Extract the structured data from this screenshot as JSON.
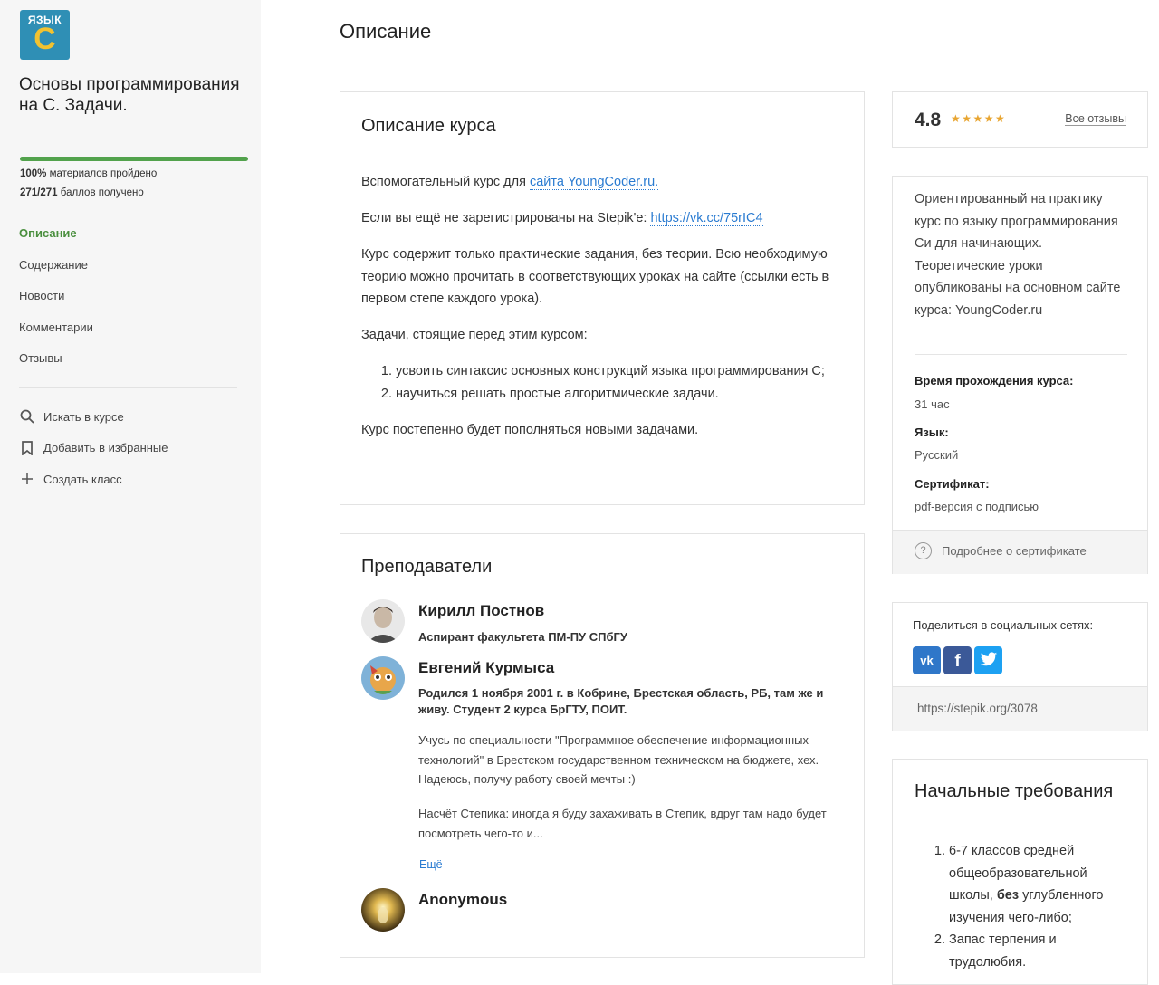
{
  "sidebar": {
    "logo": {
      "word": "ЯЗЫК",
      "letter": "С"
    },
    "course_title": "Основы программирования на С. Задачи.",
    "progress": {
      "fraction": 1.0,
      "materials_value": "100%",
      "materials_text": "материалов пройдено",
      "points_value": "271/271",
      "points_text": "баллов получено"
    },
    "nav": [
      {
        "label": "Описание",
        "active": true
      },
      {
        "label": "Содержание"
      },
      {
        "label": "Новости"
      },
      {
        "label": "Комментарии"
      },
      {
        "label": "Отзывы"
      }
    ],
    "actions": [
      {
        "label": "Искать в курсе",
        "icon": "search-icon"
      },
      {
        "label": "Добавить в избранные",
        "icon": "bookmark-icon"
      },
      {
        "label": "Создать класс",
        "icon": "plus-icon"
      }
    ]
  },
  "main": {
    "page_title": "Описание",
    "description": {
      "heading": "Описание курса",
      "p1_prefix": "Вспомогательный курс для ",
      "p1_link": "сайта YoungCoder.ru.",
      "p2_prefix": "Если вы ещё не зарегистрированы на Stepik'е: ",
      "p2_link": "https://vk.cc/75rIC4",
      "p3": "Курс содержит только практические задания, без теории. Всю необходимую теорию можно прочитать в соответствующих уроках на сайте (ссылки есть в первом степе каждого урока).",
      "p4": "Задачи, стоящие перед этим курсом:",
      "goals": [
        "усвоить синтаксис основных конструкций языка программирования С;",
        "научиться решать простые алгоритмические задачи."
      ],
      "p5": "Курс постепенно будет пополняться новыми задачами."
    },
    "teachers": {
      "heading": "Преподаватели",
      "list": [
        {
          "name": "Кирилл Постнов",
          "subtitle": "Аспирант факультета ПМ-ПУ СПбГУ"
        },
        {
          "name": "Евгений Курмыса",
          "subtitle": "Родился 1 ноября 2001 г. в Кобрине, Брестская область, РБ, там же и живу. Студент 2 курса БрГТУ, ПОИТ.",
          "bio1": "Учусь по специальности \"Программное обеспечение информационных технологий\" в Брестском государственном техническом на бюджете, хех. Надеюсь, получу работу своей мечты :)",
          "bio2": "Насчёт Степика: иногда я буду захаживать в Степик, вдруг там надо будет посмотреть чего-то и...",
          "more": "Ещё"
        },
        {
          "name": "Anonymous"
        }
      ]
    }
  },
  "right": {
    "rating": {
      "value": "4.8",
      "stars": "★★★★★",
      "all_reviews": "Все отзывы"
    },
    "info": {
      "summary": "Ориентированный на практику курс по языку программирования Си для начинающих. Теоретические уроки опубликованы на основном сайте курса: YoungCoder.ru",
      "duration_label": "Время прохождения курса:",
      "duration_value": "31 час",
      "language_label": "Язык:",
      "language_value": "Русский",
      "certificate_label": "Сертификат:",
      "certificate_value": "pdf-версия с подписью",
      "certificate_more": "Подробнее о сертификате"
    },
    "share": {
      "title": "Поделиться в социальных сетях:",
      "networks": [
        {
          "icon": "vk-icon",
          "glyph": "vk",
          "color": "#2f77c9"
        },
        {
          "icon": "facebook-icon",
          "glyph": "f",
          "color": "#3b5998"
        },
        {
          "icon": "twitter-icon",
          "glyph": "t",
          "color": "#1da1f2"
        }
      ],
      "url": "https://stepik.org/3078"
    },
    "requirements": {
      "title": "Начальные требования",
      "item1_before": "6-7 классов средней общеобразовательной школы, ",
      "item1_bold": "без",
      "item1_after": " углубленного изучения чего-либо;",
      "item2": "Запас терпения и трудолюбия."
    }
  },
  "colors": {
    "accent_green": "#52a24c",
    "link_blue": "#2a7bd1",
    "star_orange": "#e8a531"
  }
}
